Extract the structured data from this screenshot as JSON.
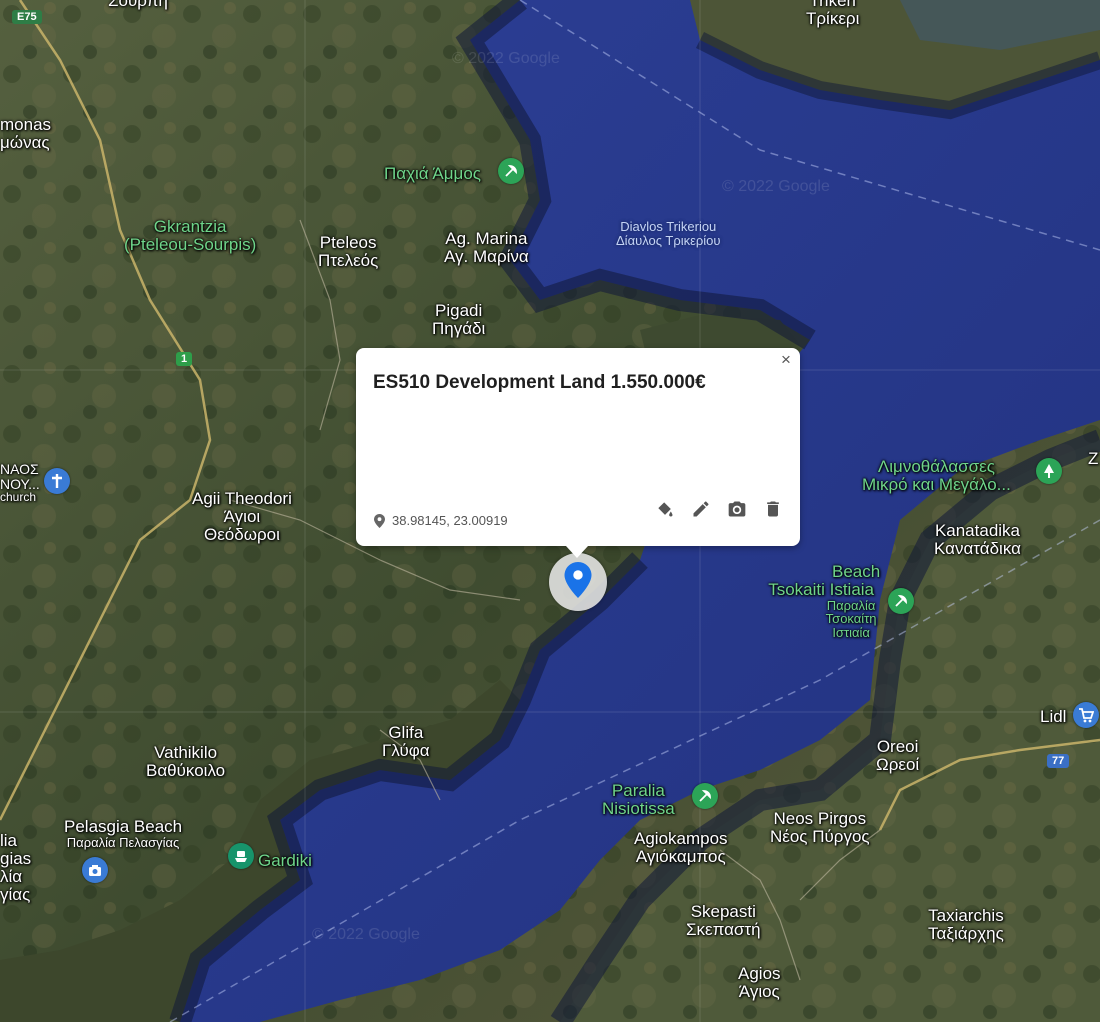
{
  "info_window": {
    "title": "ES510 Development Land 1.550.000€",
    "coordinates": "38.98145, 23.00919",
    "close_label": "×",
    "tools": [
      "paint-bucket-icon",
      "pencil-icon",
      "camera-icon",
      "trash-icon"
    ]
  },
  "colors": {
    "marker": "#1a73e8",
    "sea": "#26378a",
    "land": "#4a5638",
    "green_label": "#6fd58a"
  },
  "places": {
    "sourpi": "Σούρπη",
    "trikeri_en": "Trikeri",
    "trikeri_gr": "Τρίκερι",
    "almonas_en": "monas",
    "almonas_gr": "μώνας",
    "pachia_ammos": "Παχιά Άμμος",
    "gkrantzia_1": "Gkrantzia",
    "gkrantzia_2": "(Pteleou-Sourpis)",
    "pteleos_en": "Pteleos",
    "pteleos_gr": "Πτελεός",
    "ag_marina_en": "Ag. Marina",
    "ag_marina_gr": "Αγ. Μαρίνα",
    "diavlos_en": "Diavlos Trikeriou",
    "diavlos_gr": "Δίαυλος Τρικερίου",
    "pigadi_en": "Pigadi",
    "pigadi_gr": "Πηγάδι",
    "naos_1": "ΝΑΟΣ",
    "naos_2": "ΝΟΥ...",
    "naos_3": "church",
    "agii_theodori_en": "Agii Theodori",
    "agii_theodori_gr1": "Άγιοι",
    "agii_theodori_gr2": "Θεόδωροι",
    "limnothalasses_1": "Λιμνοθάλασσες",
    "limnothalasses_2": "Μικρό και Μεγάλο...",
    "z": "Z",
    "kanatadika_en": "Kanatadika",
    "kanatadika_gr": "Κανατάδικα",
    "tsokaiti_1": "Beach",
    "tsokaiti_2": "Tsokaiti Istiaia",
    "tsokaiti_3": "Παραλία",
    "tsokaiti_4": "Τσοκαίτη",
    "tsokaiti_5": "Ιστιαία",
    "lidl": "Lidl",
    "glifa_en": "Glifa",
    "glifa_gr": "Γλύφα",
    "vathikilo_en": "Vathikilo",
    "vathikilo_gr": "Βαθύκοιλο",
    "oreoi_en": "Oreoi",
    "oreoi_gr": "Ωρεοί",
    "paralia_nis_1": "Paralia",
    "paralia_nis_2": "Nisiotissa",
    "pelasgia_en": "Pelasgia Beach",
    "pelasgia_gr": "Παραλία Πελασγίας",
    "gardiki": "Gardiki",
    "agiokampos_en": "Agiokampos",
    "agiokampos_gr": "Αγιόκαμπος",
    "neos_pirgos_en": "Neos Pirgos",
    "neos_pirgos_gr": "Νέος Πύργος",
    "left_edge_1": "lia",
    "left_edge_2": "gias",
    "left_edge_3": "λία",
    "left_edge_4": "γίας",
    "skepasti_en": "Skepasti",
    "skepasti_gr": "Σκεπαστή",
    "taxiarchis_en": "Taxiarchis",
    "taxiarchis_gr": "Ταξιάρχης",
    "agios_en": "Agios",
    "agios_gr": "Άγιος"
  },
  "road_signs": {
    "e75": "E75",
    "r1": "1",
    "r77": "77"
  },
  "watermarks": [
    "© 2022 Google",
    "© 2022 Google",
    "© 2022 Google"
  ]
}
